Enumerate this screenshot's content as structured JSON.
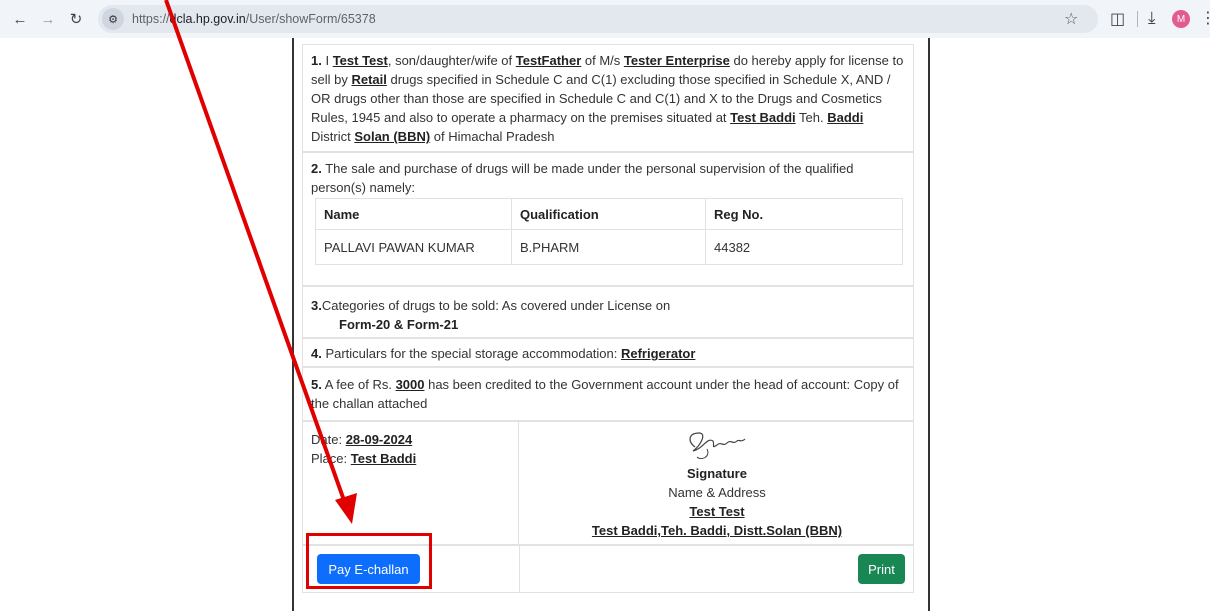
{
  "browser": {
    "url_prefix": "https://",
    "url_host": "dcla.hp.gov.in",
    "url_path": "/User/showForm/65378",
    "avatar_letter": "M"
  },
  "form": {
    "s1": {
      "num": "1.",
      "t1": " I ",
      "applicant": "Test Test",
      "t2": ", son/daughter/wife of ",
      "father": "TestFather",
      "t3": " of M/s ",
      "firm": "Tester Enterprise",
      "t4": " do hereby apply for license to sell by ",
      "sale_type": "Retail",
      "t5": " drugs specified in Schedule C and C(1) excluding those specified in Schedule X, AND / OR drugs other than those are specified in Schedule C and C(1) and X to the Drugs and Cosmetics Rules, 1945 and also to operate a pharmacy on the premises situated at ",
      "premises": "Test Baddi",
      "t6": " Teh. ",
      "tehsil": "Baddi",
      "t7": " District ",
      "district": "Solan (BBN)",
      "t8": " of Himachal Pradesh"
    },
    "s2": {
      "num": "2.",
      "text": " The sale and purchase of drugs will be made under the personal supervision of the qualified person(s) namely:",
      "headers": [
        "Name",
        "Qualification",
        "Reg No."
      ],
      "row": [
        "PALLAVI PAWAN KUMAR",
        "B.PHARM",
        "44382"
      ]
    },
    "s3": {
      "num": "3.",
      "text": "Categories of drugs to be sold: As covered under License on",
      "forms": "Form-20 & Form-21"
    },
    "s4": {
      "num": "4.",
      "text": " Particulars for the special storage accommodation: ",
      "storage": "Refrigerator"
    },
    "s5": {
      "num": "5.",
      "t1": " A fee of Rs. ",
      "fee": "3000",
      "t2": " has been credited to the Government account under the head of account: Copy of the challan attached"
    },
    "s6": {
      "date_label": "Date: ",
      "date": "28-09-2024",
      "place_label": "Place: ",
      "place": "Test Baddi",
      "signature_label": "Signature",
      "name_address_label": "Name & Address",
      "signer_name": "Test Test",
      "signer_address": "Test Baddi,Teh. Baddi, Distt.Solan (BBN)"
    },
    "buttons": {
      "pay": "Pay E-challan",
      "print": "Print"
    }
  },
  "colors": {
    "pay_button": "#0d6efd",
    "print_button": "#198754",
    "annotation": "#e00000"
  }
}
